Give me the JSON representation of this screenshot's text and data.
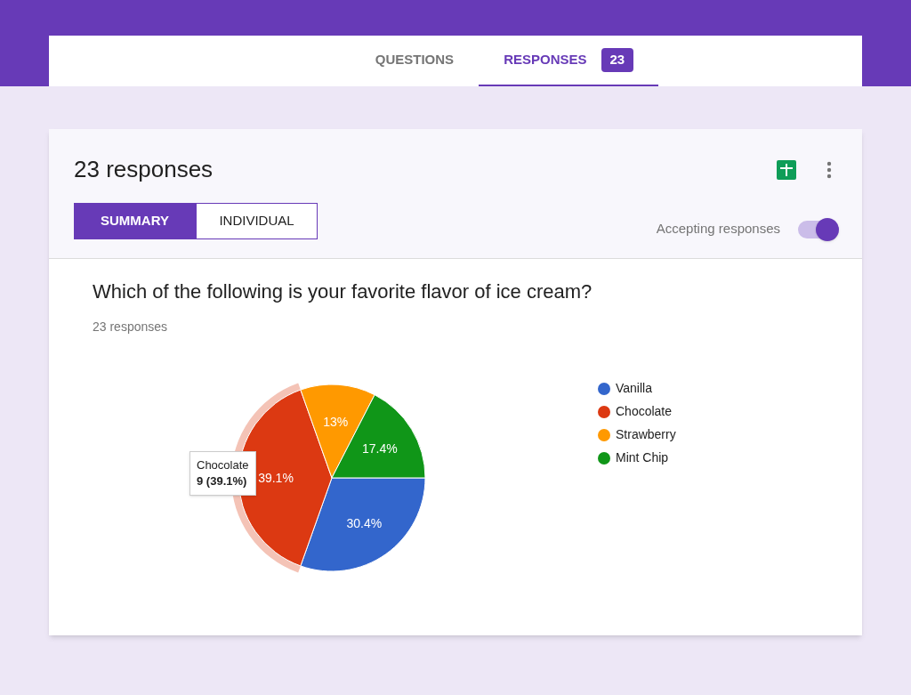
{
  "tabs": [
    {
      "label": "QUESTIONS",
      "selected": false
    },
    {
      "label": "RESPONSES",
      "selected": true,
      "badge": "23"
    }
  ],
  "card": {
    "title": "23 responses",
    "view_toggle": [
      {
        "label": "SUMMARY",
        "selected": true
      },
      {
        "label": "INDIVIDUAL",
        "selected": false
      }
    ],
    "accepting": {
      "label": "Accepting responses",
      "on": true
    }
  },
  "question": {
    "title": "Which of the following is your favorite flavor of ice cream?",
    "count": "23 responses",
    "chart_data": {
      "type": "pie",
      "categories": [
        "Vanilla",
        "Chocolate",
        "Strawberry",
        "Mint Chip"
      ],
      "values": [
        30.4,
        39.1,
        13,
        17.4
      ],
      "colors": [
        "#3366cc",
        "#dc3912",
        "#ff9900",
        "#109618"
      ],
      "data_labels": true,
      "value_labels": [
        "30.4%",
        "39.1%",
        "13%",
        "17.4%"
      ],
      "legend": "right"
    },
    "slice_states": [
      {
        "hovered": false
      },
      {
        "hovered": true
      },
      {
        "hovered": false
      },
      {
        "hovered": false
      }
    ],
    "tooltip": {
      "title": "Chocolate",
      "value": "9 (39.1%)"
    }
  }
}
